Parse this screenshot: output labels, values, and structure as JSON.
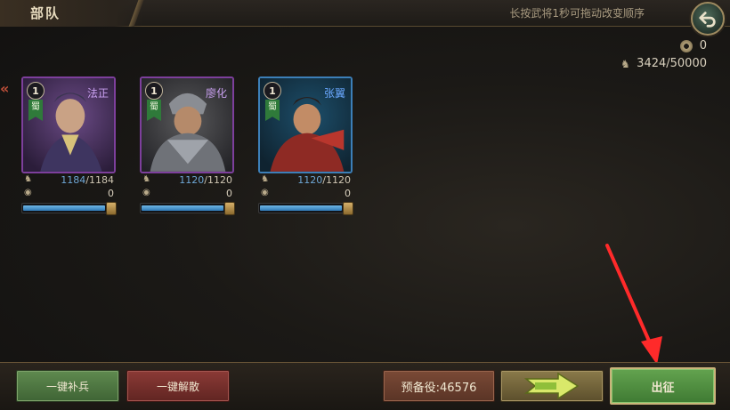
{
  "header": {
    "title": "部队",
    "hint": "长按武将1秒可拖动改变顺序"
  },
  "resources": {
    "coins": "0",
    "troops": "3424/50000"
  },
  "generals": [
    {
      "name": "法正",
      "level": "1",
      "faction": "蜀",
      "troops_current": "1184",
      "troops_max": "/1184",
      "coins": "0",
      "fill": 1.0,
      "color": "purple"
    },
    {
      "name": "廖化",
      "level": "1",
      "faction": "蜀",
      "troops_current": "1120",
      "troops_max": "/1120",
      "coins": "0",
      "fill": 1.0,
      "color": "purple"
    },
    {
      "name": "张翼",
      "level": "1",
      "faction": "蜀",
      "troops_current": "1120",
      "troops_max": "/1120",
      "coins": "0",
      "fill": 1.0,
      "color": "blue"
    }
  ],
  "bottom": {
    "replenish_label": "一键补兵",
    "disband_label": "一键解散",
    "reserve_label": "预备役:46576",
    "march_label": "出征"
  },
  "colors": {
    "purple_frame": "#7d3f9c",
    "blue_frame": "#3c7fb8",
    "march_green": "#4f8f3f",
    "annotation_red": "#ff2a2a"
  }
}
